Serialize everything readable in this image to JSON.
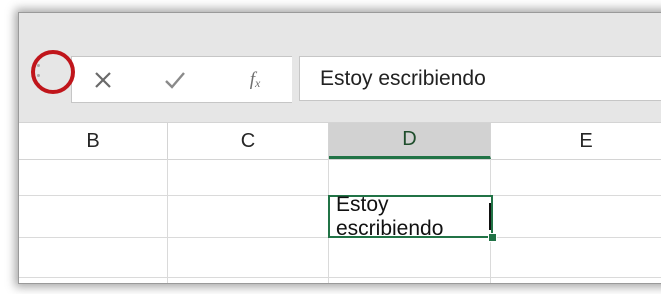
{
  "formula_bar": {
    "cancel_icon": "close-icon",
    "enter_icon": "checkmark-icon",
    "fx_label": "f",
    "fx_sub": "x",
    "content": "Estoy escribiendo"
  },
  "columns": [
    "B",
    "C",
    "D",
    "E"
  ],
  "active_column": "D",
  "active_cell": {
    "column": "D",
    "value": "Estoy escribiendo",
    "mode": "editing"
  },
  "colors": {
    "accent": "#217346",
    "highlight_circle": "#c0151b",
    "header_selected": "#d2d2d2"
  }
}
